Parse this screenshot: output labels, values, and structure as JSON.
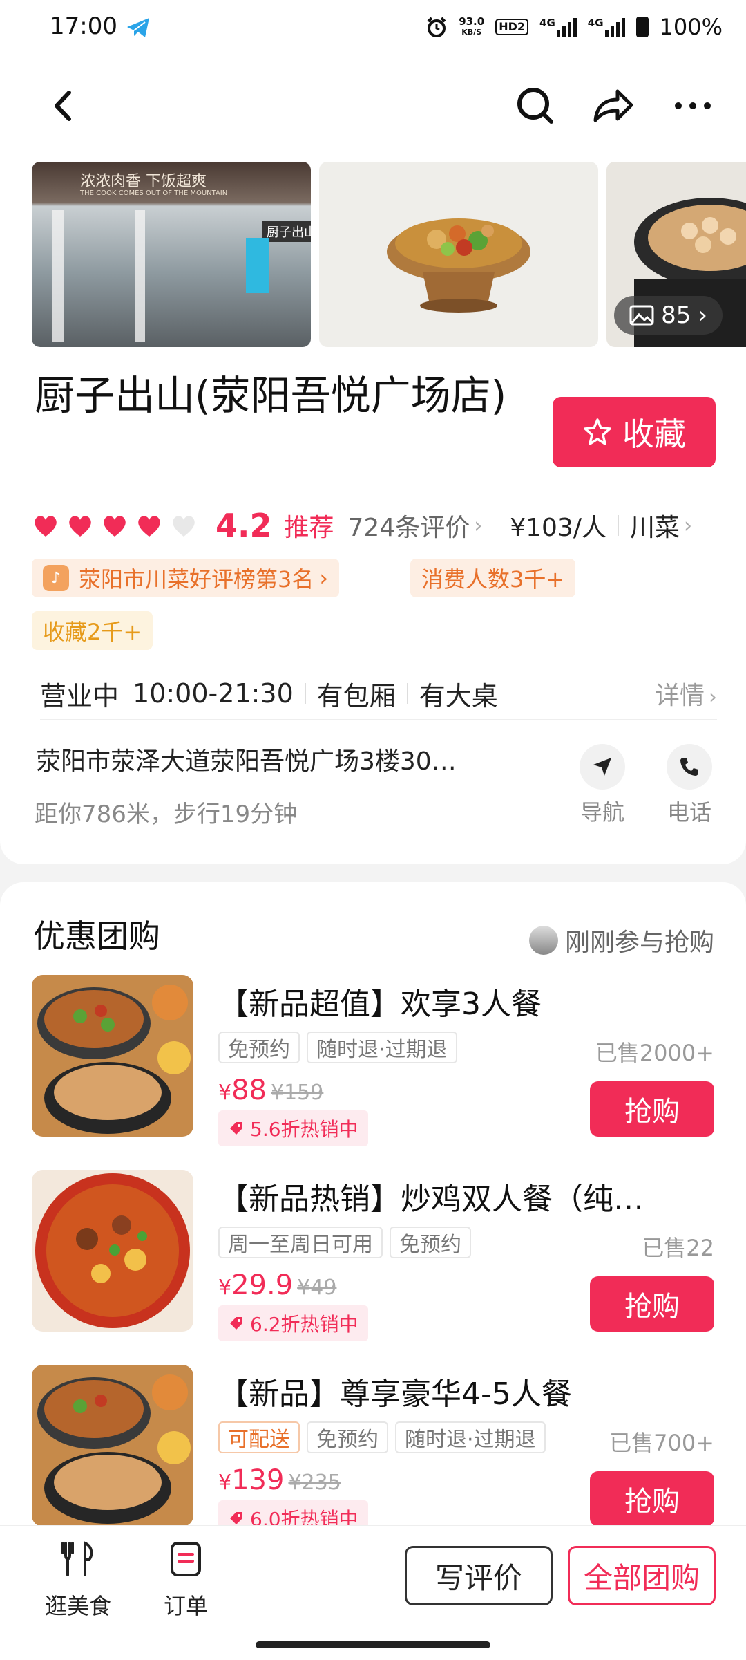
{
  "status_bar": {
    "time": "17:00",
    "speed_value": "93.0",
    "speed_unit": "KB/S",
    "hd": "HD2",
    "net1": "4G",
    "net2": "4G",
    "battery": "100%"
  },
  "nav": {
    "back_icon": "back-arrow-icon",
    "search_icon": "search-icon",
    "share_icon": "share-icon",
    "more_icon": "more-icon"
  },
  "gallery": {
    "photo_count": "85",
    "storefront_sign": "浓浓肉香 下饭超爽",
    "storefront_sub": "THE COOK COMES OUT OF THE MOUNTAIN",
    "storefront_name": "厨子出山"
  },
  "shop": {
    "name": "厨子出山(荥阳吾悦广场店)",
    "favorite_label": "收藏",
    "rating": "4.2",
    "recommend_label": "推荐",
    "reviews": "724条评价",
    "price_per_person": "¥103/人",
    "cuisine": "川菜",
    "tags": {
      "rank": "荥阳市川菜好评榜第3名",
      "consumers": "消费人数3千+",
      "favorites": "收藏2千+"
    },
    "hours_status": "营业中",
    "hours": "10:00-21:30",
    "feature1": "有包厢",
    "feature2": "有大桌",
    "details_label": "详情",
    "address": "荥阳市荥泽大道荥阳吾悦广场3楼30…",
    "distance": "距你786米，步行19分钟",
    "navigate_label": "导航",
    "phone_label": "电话"
  },
  "deals": {
    "title": "优惠团购",
    "recent": "刚刚参与抢购",
    "items": [
      {
        "name": "【新品超值】欢享3人餐",
        "badges": [
          "免预约",
          "随时退·过期退"
        ],
        "sold": "已售2000+",
        "price": "88",
        "original": "¥159",
        "discount": "5.6折热销中",
        "buy_label": "抢购"
      },
      {
        "name": "【新品热销】炒鸡双人餐（纯…",
        "badges": [
          "周一至周日可用",
          "免预约"
        ],
        "sold": "已售22",
        "price": "29.9",
        "original": "¥49",
        "discount": "6.2折热销中",
        "buy_label": "抢购"
      },
      {
        "name": "【新品】尊享豪华4-5人餐",
        "badges": [
          "可配送",
          "免预约",
          "随时退·过期退"
        ],
        "sold": "已售700+",
        "price": "139",
        "original": "¥235",
        "discount": "6.0折热销中",
        "buy_label": "抢购"
      }
    ],
    "currency": "¥"
  },
  "bottom": {
    "tab_food": "逛美食",
    "tab_orders": "订单",
    "write_review": "写评价",
    "all_deals": "全部团购"
  },
  "colors": {
    "accent": "#f12c57",
    "orange_tag": "#e8702a",
    "heart": "#f12c57"
  }
}
